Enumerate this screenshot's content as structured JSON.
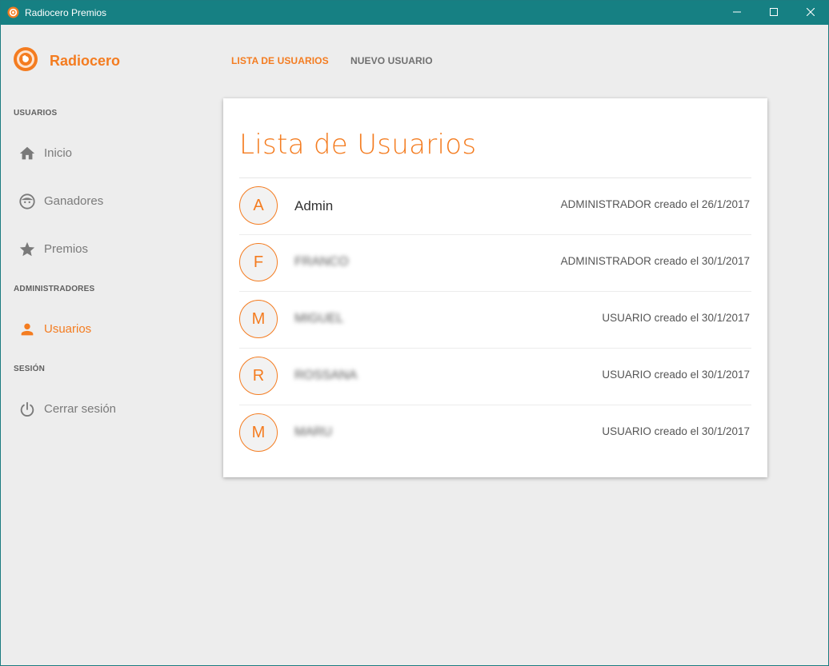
{
  "window": {
    "title": "Radiocero Premios",
    "icon": "radiocero-logo-icon",
    "controls": [
      "minimize-icon",
      "maximize-icon",
      "close-icon"
    ]
  },
  "brand": {
    "name": "Radiocero",
    "logo_icon": "radiocero-logo-icon",
    "accent_color": "#f47c20"
  },
  "sidebar": {
    "sections": [
      {
        "title": "USUARIOS",
        "items": [
          {
            "label": "Inicio",
            "icon": "home-icon",
            "active": false
          },
          {
            "label": "Ganadores",
            "icon": "face-icon",
            "active": false
          },
          {
            "label": "Premios",
            "icon": "star-icon",
            "active": false
          }
        ]
      },
      {
        "title": "ADMINISTRADORES",
        "items": [
          {
            "label": "Usuarios",
            "icon": "person-icon",
            "active": true
          }
        ]
      },
      {
        "title": "SESIÓN",
        "items": [
          {
            "label": "Cerrar sesión",
            "icon": "power-icon",
            "active": false
          }
        ]
      }
    ]
  },
  "tabs": [
    {
      "label": "LISTA DE USUARIOS",
      "active": true
    },
    {
      "label": "NUEVO USUARIO",
      "active": false
    }
  ],
  "card": {
    "title": "Lista de Usuarios",
    "users": [
      {
        "initial": "A",
        "name": "Admin",
        "blurred": false,
        "meta": "ADMINISTRADOR creado el 26/1/2017"
      },
      {
        "initial": "F",
        "name": "FRANCO",
        "blurred": true,
        "meta": "ADMINISTRADOR creado el 30/1/2017"
      },
      {
        "initial": "M",
        "name": "MIGUEL",
        "blurred": true,
        "meta": "USUARIO creado el 30/1/2017"
      },
      {
        "initial": "R",
        "name": "ROSSANA",
        "blurred": true,
        "meta": "USUARIO creado el 30/1/2017"
      },
      {
        "initial": "M",
        "name": "MARU",
        "blurred": true,
        "meta": "USUARIO creado el 30/1/2017"
      }
    ]
  }
}
